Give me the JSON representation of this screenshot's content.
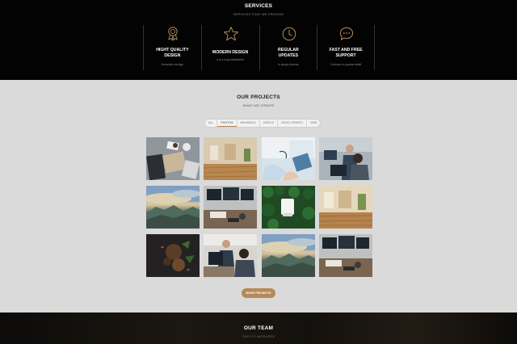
{
  "services": {
    "title": "SERVICES",
    "subtitle": "SERVICES THAT WE PROVIDE",
    "items": [
      {
        "icon": "award-ribbon-icon",
        "title_line1": "HIGHT QUALITY",
        "title_line2": "DESIGN",
        "desc": "Descrição de algo"
      },
      {
        "icon": "star-icon",
        "title_line1": "MODERN DESIGN",
        "title_line2": "",
        "desc": "It is a long established"
      },
      {
        "icon": "clock-icon",
        "title_line1": "REGULAR",
        "title_line2": "UPDATES",
        "desc": "Is simply dummy"
      },
      {
        "icon": "chat-bubble-icon",
        "title_line1": "FAST AND FREE",
        "title_line2": "SUPPORT",
        "desc": "Contrary to popular belief"
      }
    ],
    "accent_color": "#b58a58"
  },
  "projects": {
    "title": "OUR PROJECTS",
    "subtitle": "WHAT WE CREATE",
    "filters": [
      "ALL",
      "PHOTOS",
      "BRANDING",
      "VIDEOS",
      "DEVELOPMENT",
      "WEB"
    ],
    "active_filter": "PHOTOS",
    "thumbnails": [
      "desk-laptop-notebook-photo",
      "wooden-table-bar-photo",
      "hands-on-laptop-photo",
      "man-at-computer-photo",
      "mountain-landscape-photo",
      "desk-with-monitors-photo",
      "white-object-on-green-leaves-photo",
      "wooden-table-bar-photo",
      "coffee-beans-photo",
      "man-at-computer-photo",
      "mountain-landscape-photo",
      "desk-with-monitors-photo"
    ],
    "more_button": "MORE PROJECTS",
    "button_color": "#b58a58"
  },
  "team": {
    "title": "OUR TEAM",
    "subtitle": "OUR CO-WORKERS"
  }
}
